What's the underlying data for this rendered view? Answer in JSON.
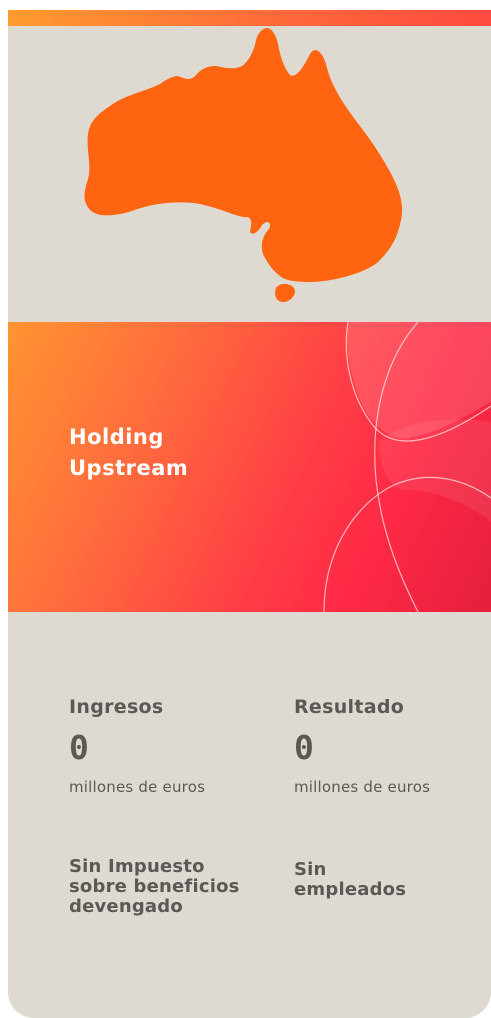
{
  "banner": {
    "title_line1": "Holding",
    "title_line2": "Upstream"
  },
  "map": {
    "icon": "australia-map-icon",
    "color": "#ff6410"
  },
  "stats": {
    "revenue": {
      "label": "Ingresos",
      "value": "0",
      "unit": "millones de euros"
    },
    "result": {
      "label": "Resultado",
      "value": "0",
      "unit": "millones de euros"
    },
    "tax": {
      "line1": "Sin Impuesto",
      "line2": "sobre beneficios",
      "line3": "devengado"
    },
    "employees": {
      "line1": "Sin",
      "line2": "empleados"
    }
  },
  "colors": {
    "card_background": "#dedad1",
    "text": "#5c5856",
    "accent_orange": "#ff9431",
    "accent_red": "#ff2a45"
  }
}
